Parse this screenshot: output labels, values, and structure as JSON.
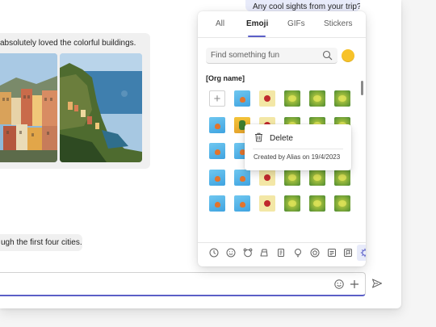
{
  "chat": {
    "outgoing_message": "Any cool sights from your trip??",
    "incoming_message": "absolutely loved the colorful buildings.",
    "incoming_message_2": "ugh the first four cities."
  },
  "picker": {
    "tabs": [
      {
        "label": "All"
      },
      {
        "label": "Emoji"
      },
      {
        "label": "GIFs"
      },
      {
        "label": "Stickers"
      }
    ],
    "active_tab": "Emoji",
    "search_placeholder": "Find something fun",
    "skin_tone_color": "#f7c229",
    "section_title": "[Org name]",
    "emoji_rows": [
      [
        "add",
        "bird",
        "berry",
        "lemon",
        "lemon",
        "lemon"
      ],
      [
        "bird",
        "pineapple",
        "berry",
        "lemon",
        "lemon",
        "lemon"
      ],
      [
        "bird",
        "bird",
        "berry",
        "lemon",
        "lemon",
        "lemon"
      ],
      [
        "bird",
        "bird",
        "berry",
        "lemon",
        "lemon",
        "lemon"
      ],
      [
        "bird",
        "bird",
        "berry",
        "lemon",
        "lemon",
        "lemon"
      ]
    ],
    "categories": [
      {
        "name": "recent-icon"
      },
      {
        "name": "smiley-icon"
      },
      {
        "name": "animal-icon"
      },
      {
        "name": "food-icon"
      },
      {
        "name": "travel-icon"
      },
      {
        "name": "activity-icon"
      },
      {
        "name": "objects-icon"
      },
      {
        "name": "symbols-icon"
      },
      {
        "name": "flags-icon"
      },
      {
        "name": "custom-org-icon"
      }
    ],
    "active_category": "custom-org-icon"
  },
  "context_menu": {
    "delete_label": "Delete",
    "created_by": "Created by Alias on 19/4/2023"
  },
  "colors": {
    "accent": "#5b5fc7",
    "bubble_self": "#e8ebfa",
    "bubble_other": "#f0f0f0"
  }
}
